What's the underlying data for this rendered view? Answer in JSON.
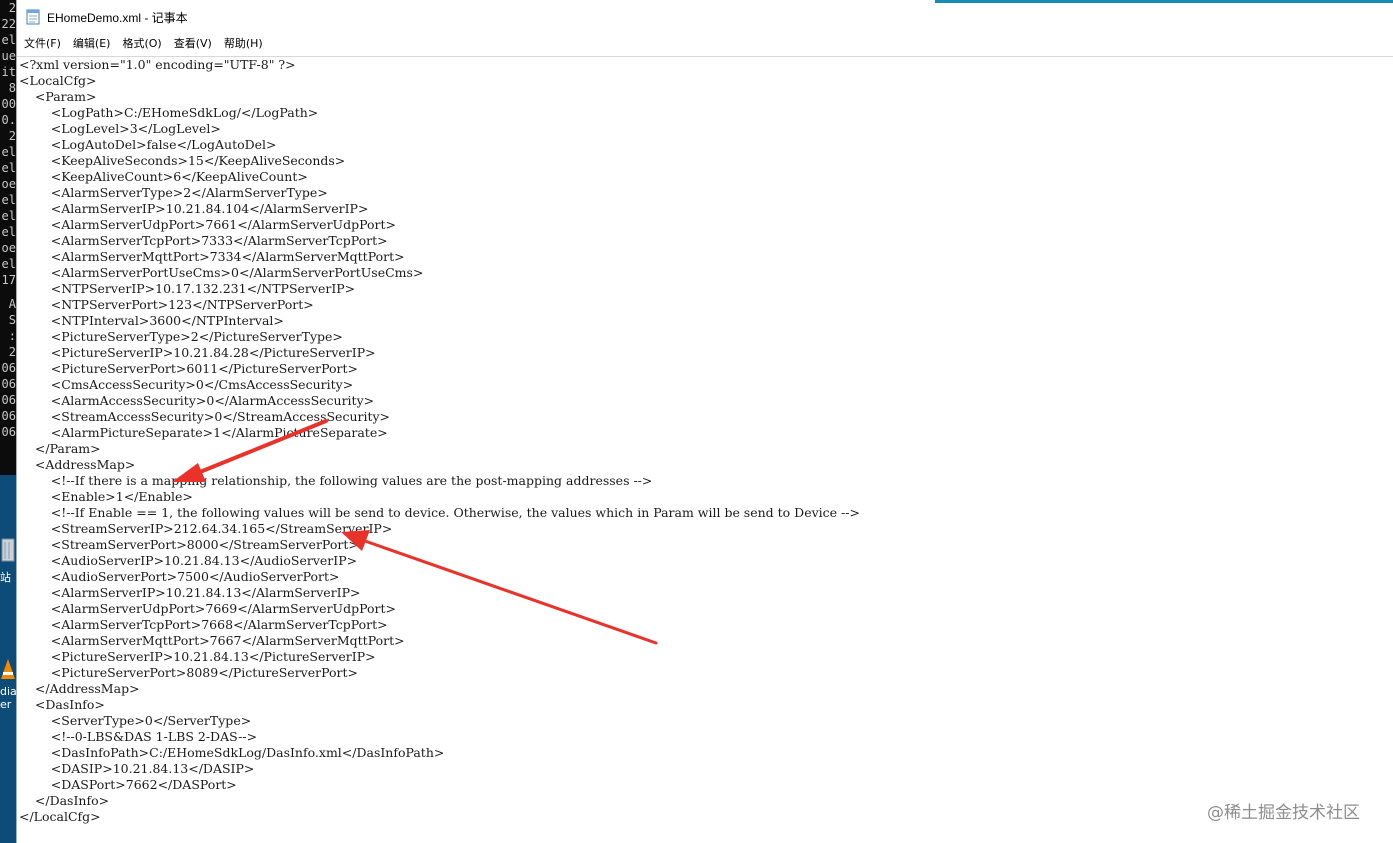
{
  "background_window": {
    "terminal_fragments": [
      "2",
      "22",
      "el",
      "ue",
      "it",
      "8",
      "00",
      "0.",
      "2",
      "el",
      "el",
      "oe",
      "el",
      "el",
      "el",
      "oe",
      "el",
      "17",
      "",
      "A",
      "S",
      ":",
      "2",
      "06",
      "06",
      "06",
      "06",
      "06"
    ],
    "desktop_labels": [
      "站",
      "dia",
      "er"
    ],
    "terminal_color": "#0c0c0c",
    "desktop_color": "#0d4c78"
  },
  "window": {
    "title": "EHomeDemo.xml - 记事本",
    "icon": "notepad-icon",
    "menu": [
      "文件(F)",
      "编辑(E)",
      "格式(O)",
      "查看(V)",
      "帮助(H)"
    ]
  },
  "editor": {
    "lines": [
      "<?xml version=\"1.0\" encoding=\"UTF-8\" ?>",
      "<LocalCfg>",
      "    <Param>",
      "        <LogPath>C:/EHomeSdkLog/</LogPath>",
      "        <LogLevel>3</LogLevel>",
      "        <LogAutoDel>false</LogAutoDel>",
      "        <KeepAliveSeconds>15</KeepAliveSeconds>",
      "        <KeepAliveCount>6</KeepAliveCount>",
      "        <AlarmServerType>2</AlarmServerType>",
      "        <AlarmServerIP>10.21.84.104</AlarmServerIP>",
      "        <AlarmServerUdpPort>7661</AlarmServerUdpPort>",
      "        <AlarmServerTcpPort>7333</AlarmServerTcpPort>",
      "        <AlarmServerMqttPort>7334</AlarmServerMqttPort>",
      "        <AlarmServerPortUseCms>0</AlarmServerPortUseCms>",
      "        <NTPServerIP>10.17.132.231</NTPServerIP>",
      "        <NTPServerPort>123</NTPServerPort>",
      "        <NTPInterval>3600</NTPInterval>",
      "        <PictureServerType>2</PictureServerType>",
      "        <PictureServerIP>10.21.84.28</PictureServerIP>",
      "        <PictureServerPort>6011</PictureServerPort>",
      "        <CmsAccessSecurity>0</CmsAccessSecurity>",
      "        <AlarmAccessSecurity>0</AlarmAccessSecurity>",
      "        <StreamAccessSecurity>0</StreamAccessSecurity>",
      "        <AlarmPictureSeparate>1</AlarmPictureSeparate>",
      "    </Param>",
      "    <AddressMap>",
      "        <!--If there is a mapping relationship, the following values are the post-mapping addresses -->",
      "        <Enable>1</Enable>",
      "        <!--If Enable == 1, the following values will be send to device. Otherwise, the values which in Param will be send to Device -->",
      "        <StreamServerIP>212.64.34.165</StreamServerIP>",
      "        <StreamServerPort>8000</StreamServerPort>",
      "        <AudioServerIP>10.21.84.13</AudioServerIP>",
      "        <AudioServerPort>7500</AudioServerPort>",
      "        <AlarmServerIP>10.21.84.13</AlarmServerIP>",
      "        <AlarmServerUdpPort>7669</AlarmServerUdpPort>",
      "        <AlarmServerTcpPort>7668</AlarmServerTcpPort>",
      "        <AlarmServerMqttPort>7667</AlarmServerMqttPort>",
      "        <PictureServerIP>10.21.84.13</PictureServerIP>",
      "        <PictureServerPort>8089</PictureServerPort>",
      "    </AddressMap>",
      "    <DasInfo>",
      "        <ServerType>0</ServerType>",
      "        <!--0-LBS&DAS 1-LBS 2-DAS-->",
      "        <DasInfoPath>C:/EHomeSdkLog/DasInfo.xml</DasInfoPath>",
      "        <DASIP>10.21.84.13</DASIP>",
      "        <DASPort>7662</DASPort>",
      "    </DasInfo>",
      "</LocalCfg>"
    ]
  },
  "annotations": {
    "arrow_color": "#e8322a"
  },
  "watermark": "@稀土掘金技术社区"
}
